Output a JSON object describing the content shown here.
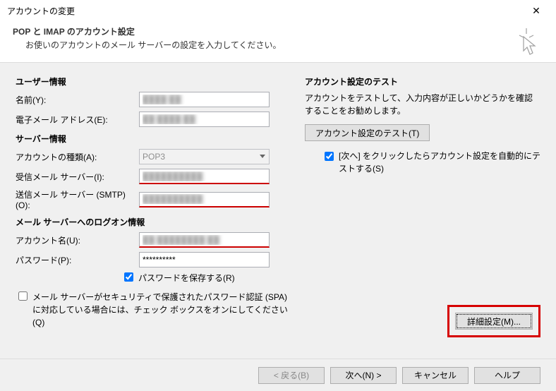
{
  "window": {
    "title": "アカウントの変更"
  },
  "header": {
    "title": "POP と IMAP のアカウント設定",
    "subtitle": "お使いのアカウントのメール サーバーの設定を入力してください。"
  },
  "left": {
    "user_info_title": "ユーザー情報",
    "name_label": "名前(Y):",
    "name_value": "████ ██",
    "email_label": "電子メール アドレス(E):",
    "email_value": "██ ████ ██",
    "server_info_title": "サーバー情報",
    "account_type_label": "アカウントの種類(A):",
    "account_type_value": "POP3",
    "incoming_label": "受信メール サーバー(I):",
    "incoming_value": "██████████",
    "outgoing_label": "送信メール サーバー (SMTP)(O):",
    "outgoing_value": "██████████",
    "logon_title": "メール サーバーへのログオン情報",
    "username_label": "アカウント名(U):",
    "username_value": "██ ████████ ██",
    "password_label": "パスワード(P):",
    "password_value": "**********",
    "save_password_label": "パスワードを保存する(R)",
    "spa_label": "メール サーバーがセキュリティで保護されたパスワード認証 (SPA) に対応している場合には、チェック ボックスをオンにしてください(Q)"
  },
  "right": {
    "test_title": "アカウント設定のテスト",
    "test_desc": "アカウントをテストして、入力内容が正しいかどうかを確認することをお勧めします。",
    "test_button": "アカウント設定のテスト(T)",
    "auto_test_label": "[次へ] をクリックしたらアカウント設定を自動的にテストする(S)",
    "advanced_button": "詳細設定(M)..."
  },
  "buttons": {
    "back": "< 戻る(B)",
    "next": "次へ(N) >",
    "cancel": "キャンセル",
    "help": "ヘルプ"
  }
}
